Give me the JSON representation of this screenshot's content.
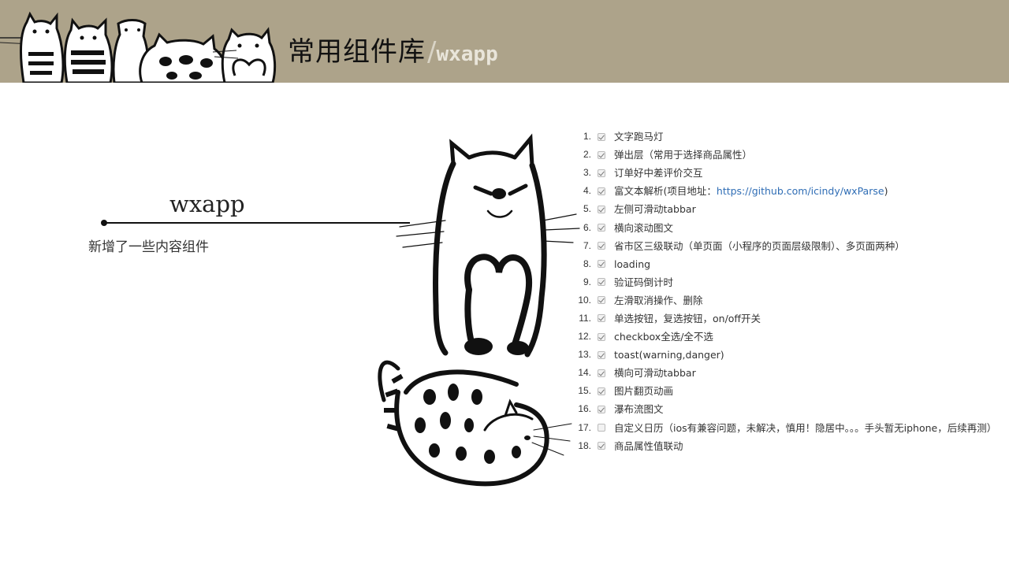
{
  "header": {
    "title": "常用组件库",
    "slash": "/",
    "subtitle": "wxapp",
    "background_color": "#ada38a"
  },
  "left_panel": {
    "label": "wxapp",
    "description": "新增了一些内容组件"
  },
  "features": [
    {
      "num": "1.",
      "checked": true,
      "text": "文字跑马灯"
    },
    {
      "num": "2.",
      "checked": true,
      "text": "弹出层（常用于选择商品属性）"
    },
    {
      "num": "3.",
      "checked": true,
      "text": "订单好中差评价交互"
    },
    {
      "num": "4.",
      "checked": true,
      "text": "富文本解析(项目地址：",
      "link": "https://github.com/icindy/wxParse",
      "suffix": ")"
    },
    {
      "num": "5.",
      "checked": true,
      "text": "左侧可滑动tabbar"
    },
    {
      "num": "6.",
      "checked": true,
      "text": "横向滚动图文"
    },
    {
      "num": "7.",
      "checked": true,
      "text": "省市区三级联动（单页面（小程序的页面层级限制）、多页面两种）"
    },
    {
      "num": "8.",
      "checked": true,
      "text": "loading"
    },
    {
      "num": "9.",
      "checked": true,
      "text": "验证码倒计时"
    },
    {
      "num": "10.",
      "checked": true,
      "text": "左滑取消操作、删除"
    },
    {
      "num": "11.",
      "checked": true,
      "text": "单选按钮，复选按钮，on/off开关"
    },
    {
      "num": "12.",
      "checked": true,
      "text": "checkbox全选/全不选"
    },
    {
      "num": "13.",
      "checked": true,
      "text": "toast(warning,danger)"
    },
    {
      "num": "14.",
      "checked": true,
      "text": "横向可滑动tabbar"
    },
    {
      "num": "15.",
      "checked": true,
      "text": "图片翻页动画"
    },
    {
      "num": "16.",
      "checked": true,
      "text": "瀑布流图文"
    },
    {
      "num": "17.",
      "checked": false,
      "text": "自定义日历（ios有兼容问题，未解决，慎用！隐居中。。。手头暂无iphone，后续再测）"
    },
    {
      "num": "18.",
      "checked": true,
      "text": "商品属性值联动"
    }
  ]
}
